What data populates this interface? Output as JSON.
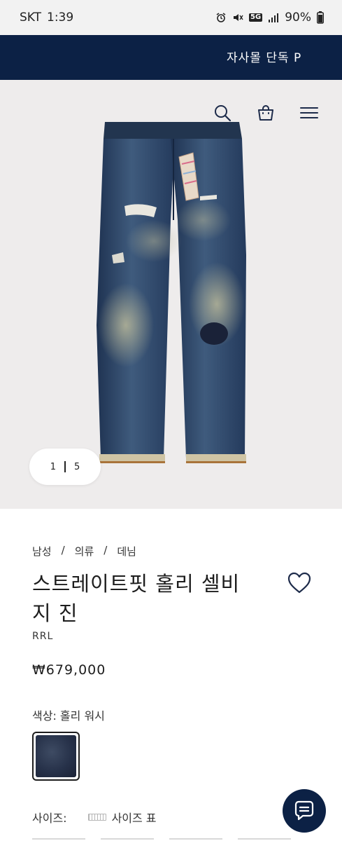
{
  "status_bar": {
    "carrier": "SKT",
    "time": "1:39",
    "network": "5G",
    "battery": "90%"
  },
  "banner": {
    "text": "자사몰 단독 P"
  },
  "hero": {
    "pager_current": "1",
    "pager_total": "5",
    "icons": [
      "search-icon",
      "shopping-bag-icon",
      "menu-icon"
    ]
  },
  "breadcrumb": [
    "남성",
    "의류",
    "데님"
  ],
  "product": {
    "title_line1": "스트레이트핏 홀리 셀비",
    "title_line2": "지 진",
    "brand": "RRL",
    "price": "₩679,000",
    "color_label": "색상: 홀리 워시",
    "size_label": "사이즈:",
    "size_guide": "사이즈 표"
  },
  "colors": {
    "navy": "#0c2145",
    "swatch": "#27324a"
  }
}
